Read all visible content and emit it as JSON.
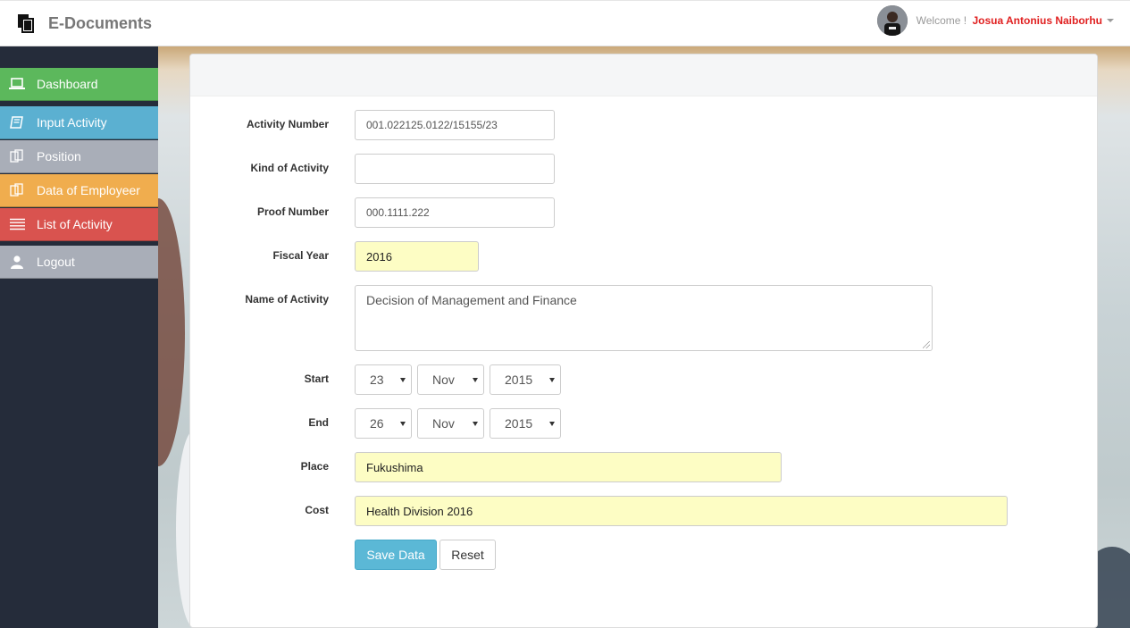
{
  "app": {
    "title": "E-Documents"
  },
  "user": {
    "welcome": "Welcome !",
    "name": "Josua Antonius Naiborhu"
  },
  "sidebar": {
    "items": [
      {
        "label": "Dashboard",
        "color": "#5cb85c"
      },
      {
        "label": "Input Activity",
        "color": "#5bb0d1"
      },
      {
        "label": "Position",
        "color": "#a9aeb8"
      },
      {
        "label": "Data of Employeer",
        "color": "#f0ad4e"
      },
      {
        "label": "List of Activity",
        "color": "#d9534f"
      },
      {
        "label": "Logout",
        "color": "#a9aeb8"
      }
    ]
  },
  "form": {
    "activity_number": {
      "label": "Activity Number",
      "value": "001.022125.0122/15155/23"
    },
    "kind_of_activity": {
      "label": "Kind of Activity",
      "value": ""
    },
    "proof_number": {
      "label": "Proof Number",
      "value": "000.1111.222"
    },
    "fiscal_year": {
      "label": "Fiscal Year",
      "value": "2016"
    },
    "name_of_activity": {
      "label": "Name of Activity",
      "value": "Decision of Management and Finance"
    },
    "start": {
      "label": "Start",
      "day": "23",
      "month": "Nov",
      "year": "2015"
    },
    "end": {
      "label": "End",
      "day": "26",
      "month": "Nov",
      "year": "2015"
    },
    "place": {
      "label": "Place",
      "value": "Fukushima"
    },
    "cost": {
      "label": "Cost",
      "value": "Health Division 2016"
    },
    "save_label": "Save Data",
    "reset_label": "Reset"
  }
}
